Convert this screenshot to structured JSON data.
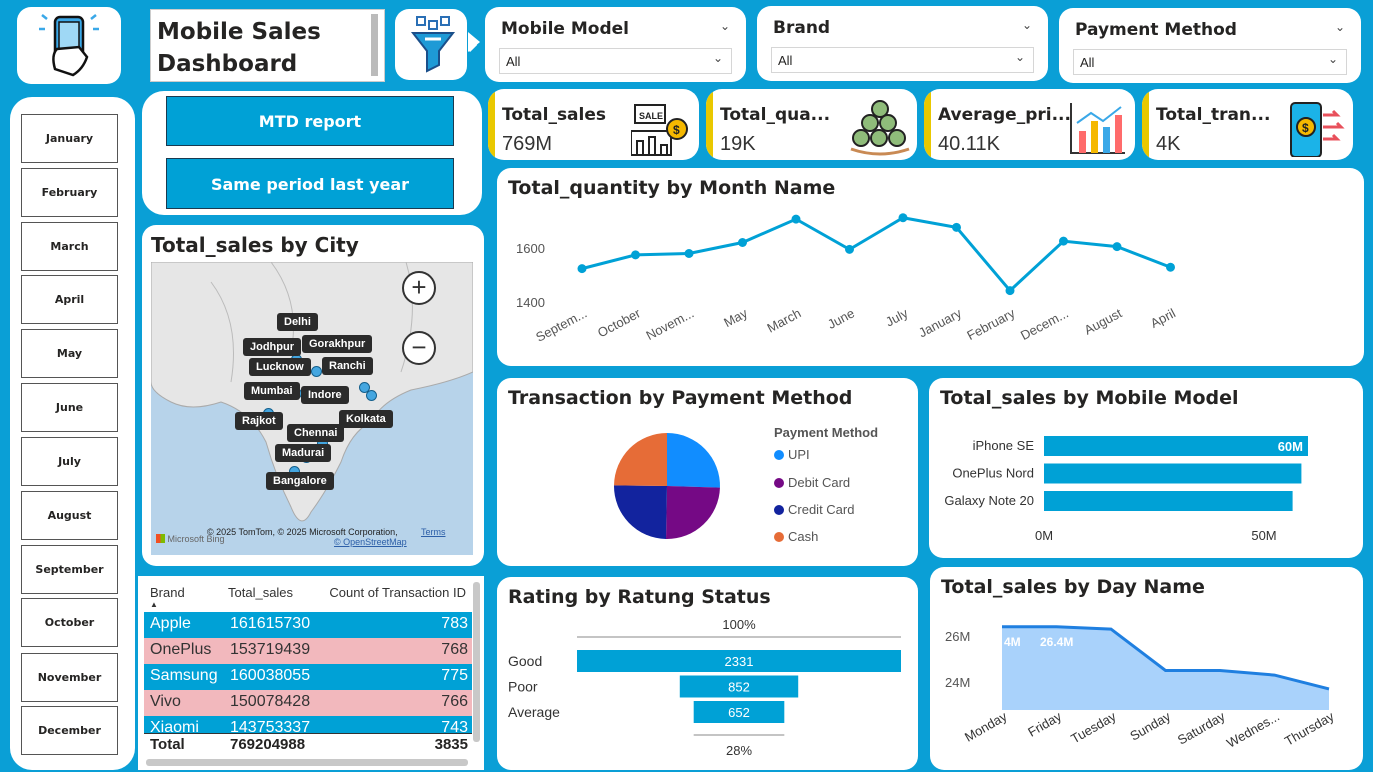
{
  "header": {
    "title": "Mobile Sales Dashboard",
    "logo_icon": "phone-in-hand-icon",
    "filter_icon": "funnel-filter-icon"
  },
  "slicers": {
    "mobile_model": {
      "label": "Mobile Model",
      "value": "All"
    },
    "brand": {
      "label": "Brand",
      "value": "All"
    },
    "payment_method": {
      "label": "Payment Method",
      "value": "All"
    }
  },
  "months": [
    "January",
    "February",
    "March",
    "April",
    "May",
    "June",
    "July",
    "August",
    "September",
    "October",
    "November",
    "December"
  ],
  "reports": {
    "mtd": "MTD report",
    "same_period": "Same period last year"
  },
  "kpis": [
    {
      "label": "Total_sales",
      "value": "769M",
      "icon": "sale-tag-coin-icon"
    },
    {
      "label": "Total_qua...",
      "value": "19K",
      "icon": "coin-stack-icon"
    },
    {
      "label": "Average_pri...",
      "value": "40.11K",
      "icon": "bar-chart-growth-icon"
    },
    {
      "label": "Total_tran...",
      "value": "4K",
      "icon": "phone-payment-transfer-icon"
    }
  ],
  "city_map": {
    "title": "Total_sales by City",
    "cities": [
      "Delhi",
      "Jodhpur",
      "Gorakhpur",
      "Lucknow",
      "Ranchi",
      "Mumbai",
      "Indore",
      "Rajkot",
      "Kolkata",
      "Chennai",
      "Madurai",
      "Bangalore"
    ],
    "credit": "© 2025 TomTom, © 2025 Microsoft Corporation,",
    "terms": "Terms",
    "osm": "© OpenStreetMap",
    "bing": "Microsoft Bing"
  },
  "brand_table": {
    "headers": [
      "Brand",
      "Total_sales",
      "Count of Transaction ID"
    ],
    "rows": [
      {
        "brand": "Apple",
        "sales": "161615730",
        "count": "783"
      },
      {
        "brand": "OnePlus",
        "sales": "153719439",
        "count": "768"
      },
      {
        "brand": "Samsung",
        "sales": "160038055",
        "count": "775"
      },
      {
        "brand": "Vivo",
        "sales": "150078428",
        "count": "766"
      },
      {
        "brand": "Xiaomi",
        "sales": "143753337",
        "count": "743"
      }
    ],
    "total": {
      "label": "Total",
      "sales": "769204988",
      "count": "3835"
    }
  },
  "chart_data": [
    {
      "type": "line",
      "title": "Total_quantity by Month Name",
      "categories": [
        "Septem...",
        "October",
        "Novem...",
        "May",
        "March",
        "June",
        "July",
        "January",
        "February",
        "Decem...",
        "August",
        "April"
      ],
      "values": [
        1525,
        1575,
        1580,
        1620,
        1705,
        1595,
        1710,
        1675,
        1445,
        1625,
        1605,
        1530
      ],
      "yticks": [
        "1600",
        "1400"
      ],
      "ylim": [
        1400,
        1600
      ]
    },
    {
      "type": "pie",
      "title": "Transaction by Payment Method",
      "legend_title": "Payment Method",
      "categories": [
        "UPI",
        "Debit Card",
        "Credit Card",
        "Cash"
      ],
      "values": [
        25.5,
        24.8,
        24.9,
        24.8
      ],
      "colors": [
        "#118dff",
        "#750985",
        "#12239e",
        "#e66c37"
      ]
    },
    {
      "type": "bar",
      "title": "Total_sales by Mobile Model",
      "categories": [
        "iPhone SE",
        "OnePlus Nord",
        "Galaxy Note 20"
      ],
      "values": [
        60,
        58.5,
        56.5
      ],
      "data_labels": [
        "60M",
        "",
        ""
      ],
      "xticks": [
        "0M",
        "50M"
      ],
      "xlim": [
        0,
        60
      ]
    },
    {
      "type": "bar",
      "title": "Rating by Ratung Status",
      "categories": [
        "Good",
        "Poor",
        "Average"
      ],
      "values": [
        2331,
        852,
        652
      ],
      "top_label": "100%",
      "bottom_label": "28%"
    },
    {
      "type": "area",
      "title": "Total_sales by Day Name",
      "categories": [
        "Monday",
        "Friday",
        "Tuesday",
        "Sunday",
        "Saturday",
        "Wednes...",
        "Thursday"
      ],
      "values": [
        26.4,
        26.4,
        26.3,
        24.5,
        24.5,
        24.3,
        23.7
      ],
      "data_labels": [
        "4M",
        "26.4M"
      ],
      "yticks": [
        "26M",
        "24M"
      ],
      "ylim": [
        24,
        26
      ]
    }
  ]
}
